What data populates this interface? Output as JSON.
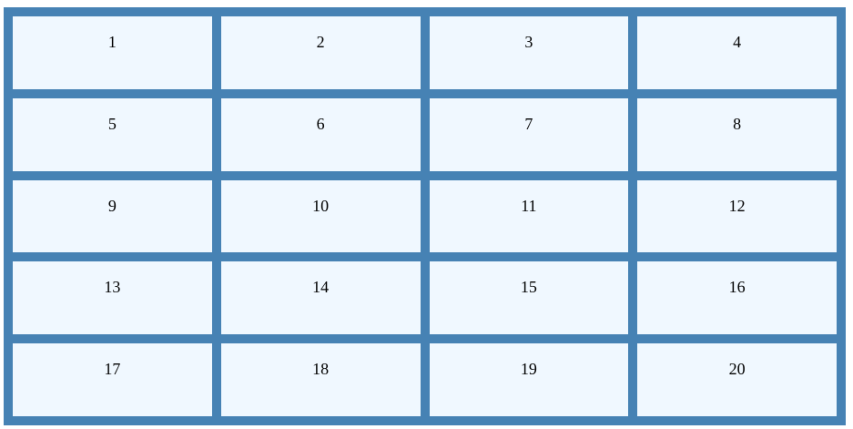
{
  "colors": {
    "grid_background": "#4682b4",
    "cell_background": "#f0f8ff",
    "text": "#000000"
  },
  "grid": {
    "cells": [
      "1",
      "2",
      "3",
      "4",
      "5",
      "6",
      "7",
      "8",
      "9",
      "10",
      "11",
      "12",
      "13",
      "14",
      "15",
      "16",
      "17",
      "18",
      "19",
      "20"
    ]
  }
}
